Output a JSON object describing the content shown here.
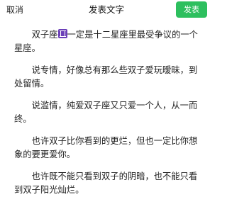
{
  "header": {
    "cancel_label": "取消",
    "title": "发表文字",
    "publish_label": "发表"
  },
  "colors": {
    "publish_button": "#2dbf5e",
    "gemini_icon": "#6b3fb8"
  },
  "post": {
    "p1_before_icon": "双子座",
    "p1_icon": "gemini-icon",
    "p1_after_icon": "一定是十二星座里最受争议的一个星座。",
    "p2": "说专情，好像总有那么些双子爱玩暧昧，到处留情。",
    "p3": "说滥情，纯爱双子座又只爱一个人，从一而终。",
    "p4": "也许双子比你看到的更烂，但也一定比你想象的要更爱你。",
    "p5": "也许既不能只看到双子的阴暗，也不能只看到双子阳光灿烂。"
  }
}
